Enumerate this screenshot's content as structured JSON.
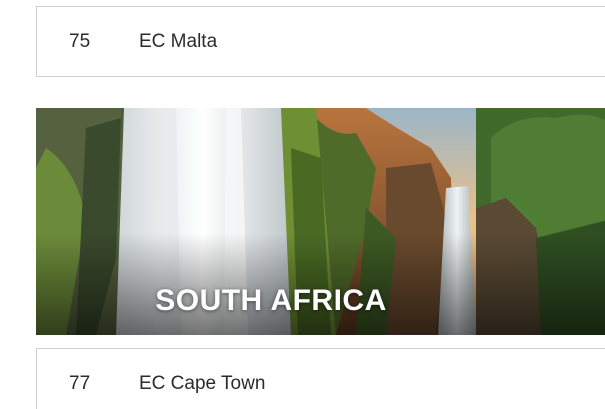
{
  "rows": [
    {
      "number": "75",
      "label": "EC Malta"
    },
    {
      "number": "77",
      "label": "EC Cape Town"
    }
  ],
  "banner": {
    "title": "SOUTH AFRICA",
    "image": "waterfall-landscape-image"
  }
}
